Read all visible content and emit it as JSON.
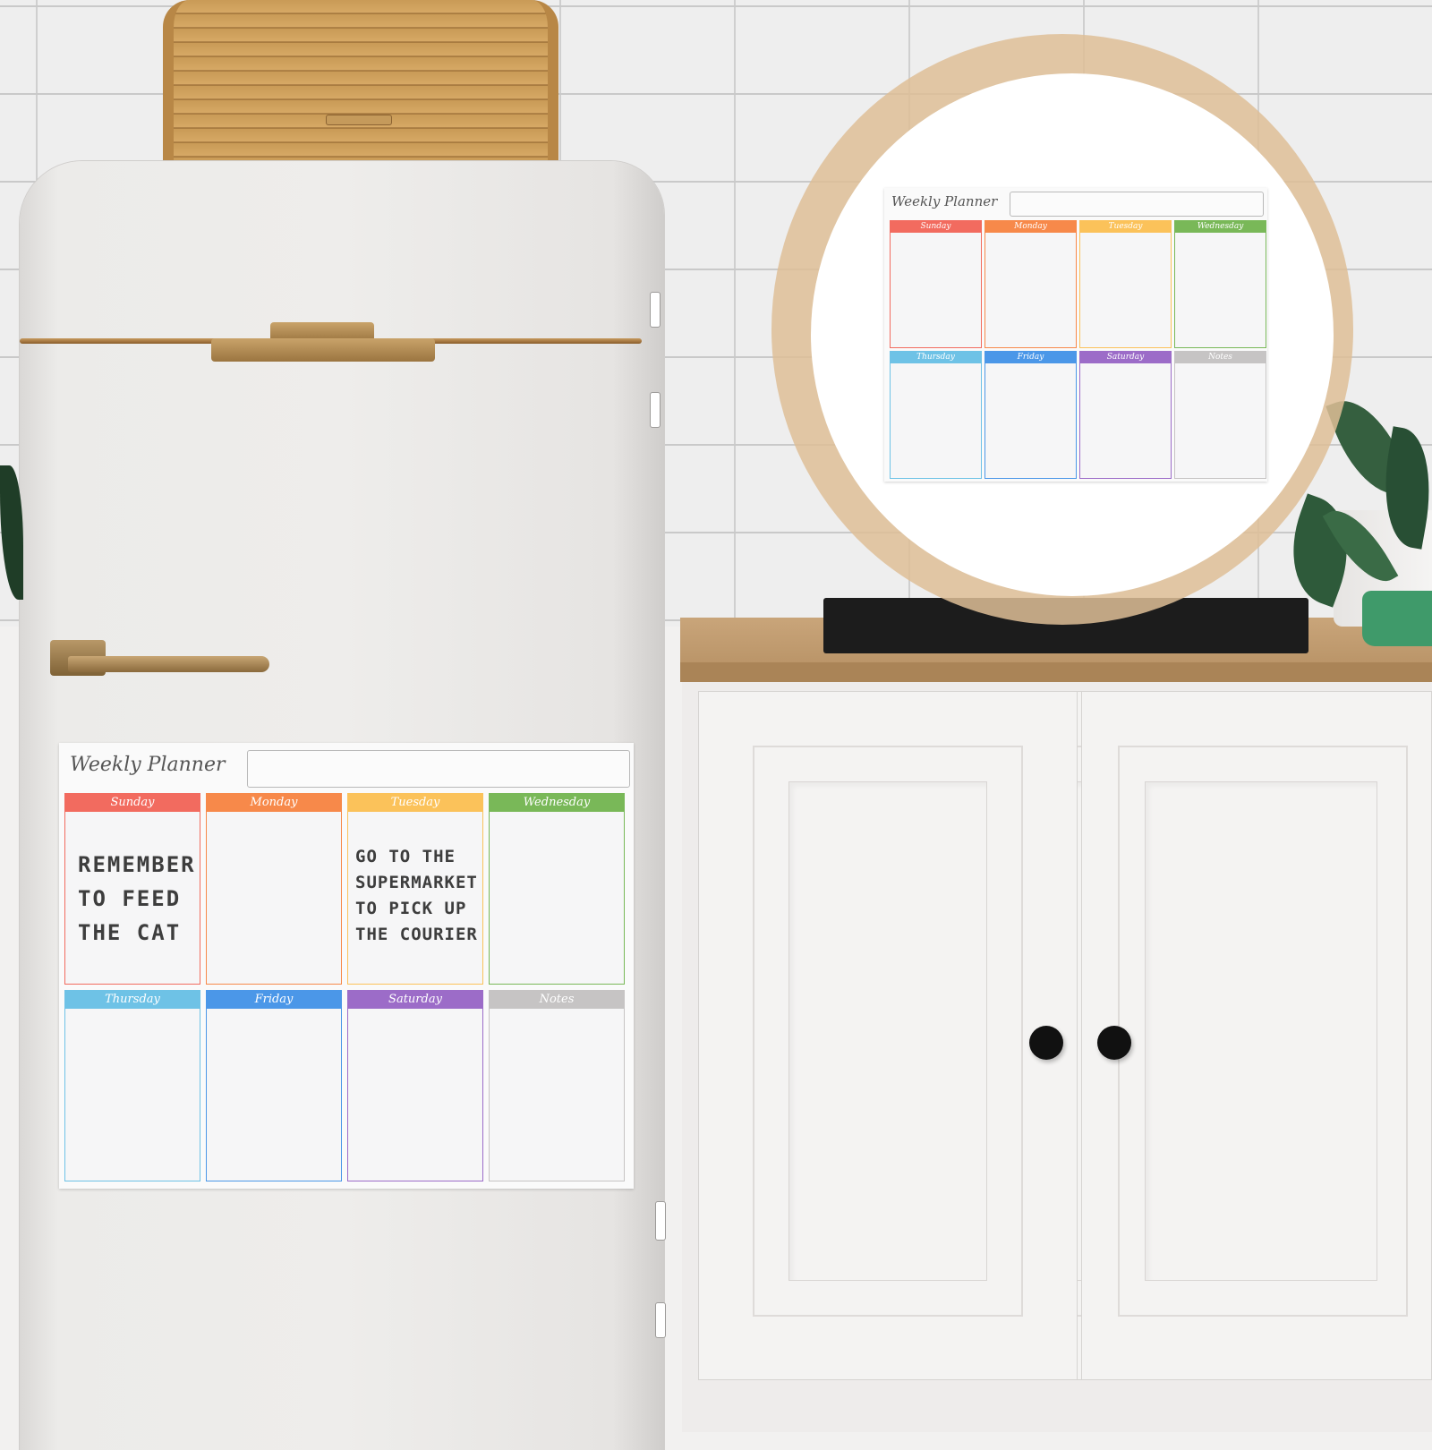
{
  "scene": {
    "description": "Kitchen with retro white refrigerator and cabinet; weekly planner magnet shown on fridge and in circular inset"
  },
  "colors": {
    "sunday": "#f26b5f",
    "monday": "#f7894a",
    "tuesday": "#fbc25a",
    "wednesday": "#79b858",
    "thursday": "#6ec2e6",
    "friday": "#4b97e8",
    "saturday": "#9c6cc8",
    "notes": "#c6c4c4",
    "ring": "#dfbf98",
    "knob": "#111111",
    "counter": "#c29c70"
  },
  "planner": {
    "title": "Weekly Planner",
    "title_field_value": "",
    "days": [
      {
        "key": "sunday",
        "label": "Sunday",
        "note": "REMEMBER\nTO FEED\nTHE CAT"
      },
      {
        "key": "monday",
        "label": "Monday",
        "note": ""
      },
      {
        "key": "tuesday",
        "label": "Tuesday",
        "note": "GO TO THE\nSUPERMARKET\nTO PICK UP\nTHE COURIER"
      },
      {
        "key": "wednesday",
        "label": "Wednesday",
        "note": ""
      },
      {
        "key": "thursday",
        "label": "Thursday",
        "note": ""
      },
      {
        "key": "friday",
        "label": "Friday",
        "note": ""
      },
      {
        "key": "saturday",
        "label": "Saturday",
        "note": ""
      },
      {
        "key": "notes",
        "label": "Notes",
        "note": ""
      }
    ]
  },
  "inset_planner": {
    "title": "Weekly Planner",
    "title_field_value": "",
    "days": [
      {
        "key": "sunday",
        "label": "Sunday"
      },
      {
        "key": "monday",
        "label": "Monday"
      },
      {
        "key": "tuesday",
        "label": "Tuesday"
      },
      {
        "key": "wednesday",
        "label": "Wednesday"
      },
      {
        "key": "thursday",
        "label": "Thursday"
      },
      {
        "key": "friday",
        "label": "Friday"
      },
      {
        "key": "saturday",
        "label": "Saturday"
      },
      {
        "key": "notes",
        "label": "Notes"
      }
    ]
  }
}
